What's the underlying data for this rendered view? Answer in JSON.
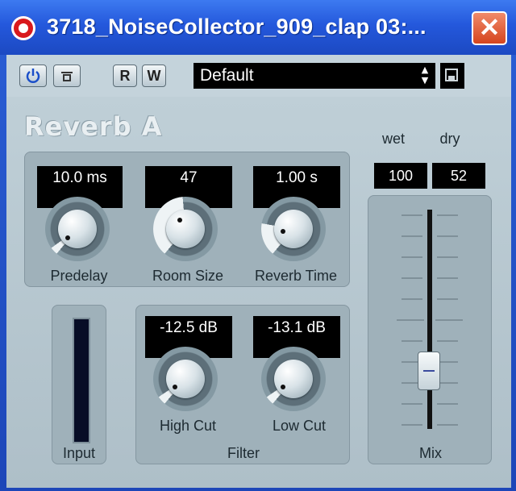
{
  "window": {
    "title": "3718_NoiseCollector_909_clap 03:...",
    "close_symbol": "✕"
  },
  "toolbar": {
    "power_icon": "power-icon",
    "bypass_icon": "bypass-icon",
    "read_label": "R",
    "write_label": "W",
    "preset_value": "Default",
    "save_icon": "save-icon"
  },
  "plugin": {
    "name": "Reverb A"
  },
  "knobs": {
    "predelay": {
      "label": "Predelay",
      "value": "10.0 ms"
    },
    "room_size": {
      "label": "Room Size",
      "value": "47"
    },
    "reverb_time": {
      "label": "Reverb Time",
      "value": "1.00 s"
    },
    "high_cut": {
      "label": "High Cut",
      "value": "-12.5 dB"
    },
    "low_cut": {
      "label": "Low Cut",
      "value": "-13.1 dB"
    }
  },
  "filter": {
    "label": "Filter"
  },
  "input": {
    "label": "Input"
  },
  "mix": {
    "label": "Mix",
    "wet_label": "wet",
    "dry_label": "dry",
    "wet_value": "100",
    "dry_value": "52"
  },
  "colors": {
    "titlebar": "#2458dc",
    "panel": "#b8c9d1",
    "display_bg": "#000000",
    "close_button": "#d5451e"
  }
}
